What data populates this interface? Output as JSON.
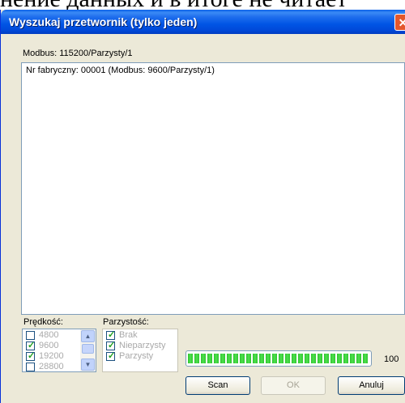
{
  "background_text": "нение данных и в итоге не читает",
  "dialog": {
    "title": "Wyszukaj przetwornik (tylko jeden)",
    "close_glyph": "✕"
  },
  "connection_label": "Modbus: 115200/Parzysty/1",
  "results": [
    "Nr fabryczny: 00001 (Modbus: 9600/Parzysty/1)"
  ],
  "speed": {
    "label": "Prędkość:",
    "options": [
      {
        "label": "4800",
        "checked": false
      },
      {
        "label": "9600",
        "checked": true
      },
      {
        "label": "19200",
        "checked": true
      },
      {
        "label": "28800",
        "checked": false
      }
    ]
  },
  "parity": {
    "label": "Parzystość:",
    "options": [
      {
        "label": "Brak",
        "checked": true
      },
      {
        "label": "Nieparzysty",
        "checked": true
      },
      {
        "label": "Parzysty",
        "checked": true
      }
    ]
  },
  "progress": {
    "value": 100,
    "display": "100"
  },
  "buttons": {
    "scan": "Scan",
    "ok": "OK",
    "cancel": "Anuluj"
  },
  "colors": {
    "title_bar": "#0055e5",
    "progress_fill": "#2fc52f",
    "checkmark": "#21a121",
    "close_button": "#e3572d"
  }
}
